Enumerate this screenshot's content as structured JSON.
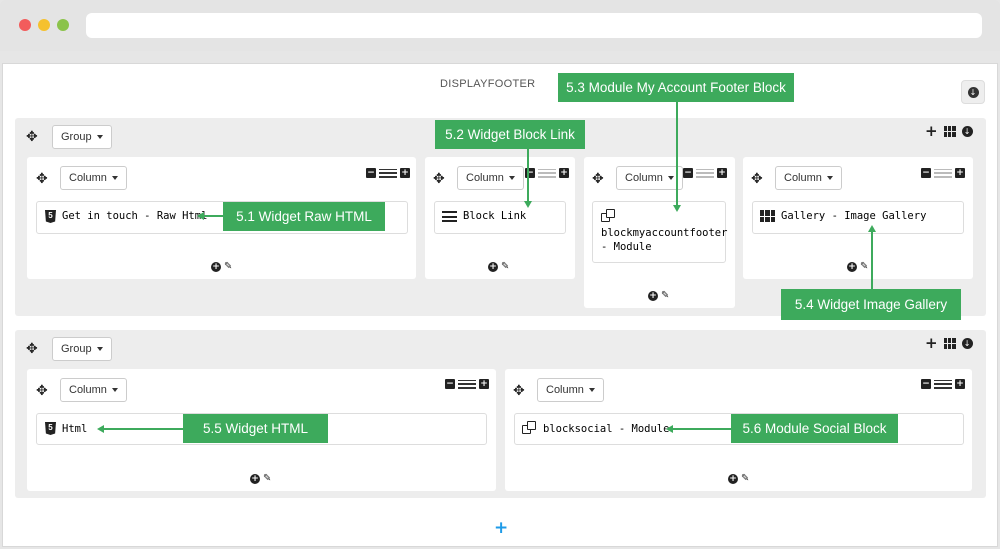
{
  "hook": {
    "title": "DISPLAYFOOTER"
  },
  "groups": [
    {
      "dropdown": "Group",
      "columns": [
        {
          "dropdown": "Column",
          "widget": "Get in touch - Raw Html",
          "icon": "html5-icon"
        },
        {
          "dropdown": "Column",
          "widget": "Block Link",
          "icon": "list-icon"
        },
        {
          "dropdown": "Column",
          "widget_line1": "blockmyaccountfooter",
          "widget_line2": "- Module",
          "icon": "module-icon"
        },
        {
          "dropdown": "Column",
          "widget": "Gallery - Image Gallery",
          "icon": "grid-icon"
        }
      ]
    },
    {
      "dropdown": "Group",
      "columns": [
        {
          "dropdown": "Column",
          "widget": "Html",
          "icon": "html5-icon"
        },
        {
          "dropdown": "Column",
          "widget": "blocksocial - Module",
          "icon": "module-icon"
        }
      ]
    }
  ],
  "annotations": {
    "a51": "5.1 Widget Raw HTML",
    "a52": "5.2 Widget Block Link",
    "a53": "5.3 Module My Account Footer Block",
    "a54": "5.4 Widget Image Gallery",
    "a55": "5.5 Widget HTML",
    "a56": "5.6 Module Social Block"
  },
  "colors": {
    "annotation": "#3daa5c",
    "add_group": "#1e9be8"
  }
}
